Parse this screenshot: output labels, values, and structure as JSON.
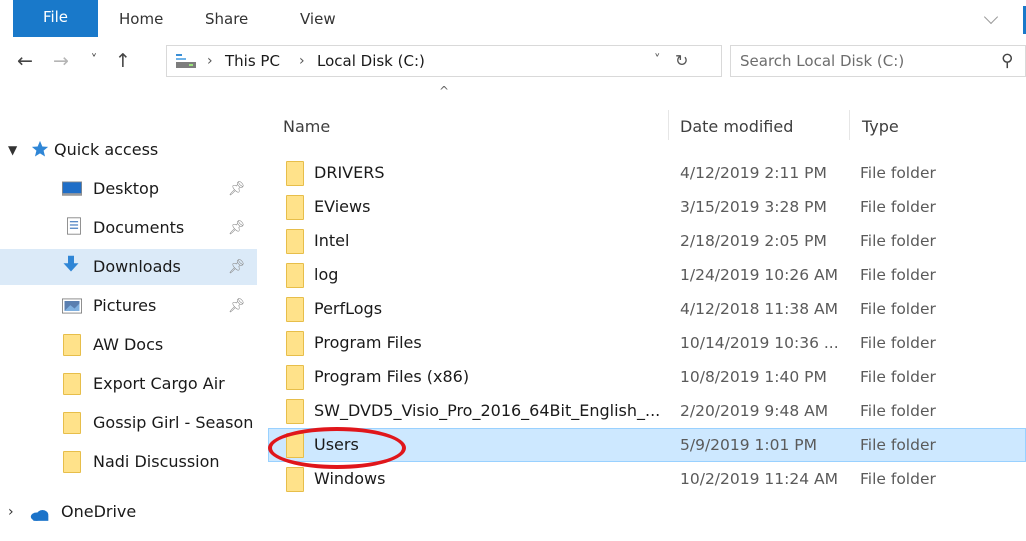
{
  "ribbon": {
    "tabs": [
      "File",
      "Home",
      "Share",
      "View"
    ]
  },
  "nav": {
    "back": "←",
    "forward": "→",
    "recent": "˅",
    "up": "↑",
    "breadcrumbs": [
      "This PC",
      "Local Disk (C:)"
    ],
    "dropdown": "˅",
    "refresh": "↻",
    "search_placeholder": "Search Local Disk (C:)",
    "search_icon": "⚲"
  },
  "sidebar": {
    "quick_access": "Quick access",
    "items": [
      {
        "label": "Desktop",
        "icon": "desktop-icon",
        "pinned": true
      },
      {
        "label": "Documents",
        "icon": "documents-icon",
        "pinned": true
      },
      {
        "label": "Downloads",
        "icon": "downloads-icon",
        "pinned": true,
        "selected": true
      },
      {
        "label": "Pictures",
        "icon": "pictures-icon",
        "pinned": true
      },
      {
        "label": "AW Docs",
        "icon": "folder-icon"
      },
      {
        "label": "Export Cargo Air",
        "icon": "folder-icon"
      },
      {
        "label": "Gossip Girl - Season",
        "icon": "folder-icon"
      },
      {
        "label": "Nadi Discussion",
        "icon": "folder-icon"
      }
    ],
    "onedrive": "OneDrive"
  },
  "columns": {
    "name": "Name",
    "date": "Date modified",
    "type": "Type"
  },
  "files": [
    {
      "name": "DRIVERS",
      "date": "4/12/2019 2:11 PM",
      "type": "File folder"
    },
    {
      "name": "EViews",
      "date": "3/15/2019 3:28 PM",
      "type": "File folder"
    },
    {
      "name": "Intel",
      "date": "2/18/2019 2:05 PM",
      "type": "File folder"
    },
    {
      "name": "log",
      "date": "1/24/2019 10:26 AM",
      "type": "File folder"
    },
    {
      "name": "PerfLogs",
      "date": "4/12/2018 11:38 AM",
      "type": "File folder"
    },
    {
      "name": "Program Files",
      "date": "10/14/2019 10:36 ...",
      "type": "File folder"
    },
    {
      "name": "Program Files (x86)",
      "date": "10/8/2019 1:40 PM",
      "type": "File folder"
    },
    {
      "name": "SW_DVD5_Visio_Pro_2016_64Bit_English_...",
      "date": "2/20/2019 9:48 AM",
      "type": "File folder"
    },
    {
      "name": "Users",
      "date": "5/9/2019 1:01 PM",
      "type": "File folder",
      "selected": true
    },
    {
      "name": "Windows",
      "date": "10/2/2019 11:24 AM",
      "type": "File folder"
    }
  ],
  "colors": {
    "accent": "#1979ca",
    "selection": "#cde8ff",
    "highlight_circle": "#e0161b"
  }
}
